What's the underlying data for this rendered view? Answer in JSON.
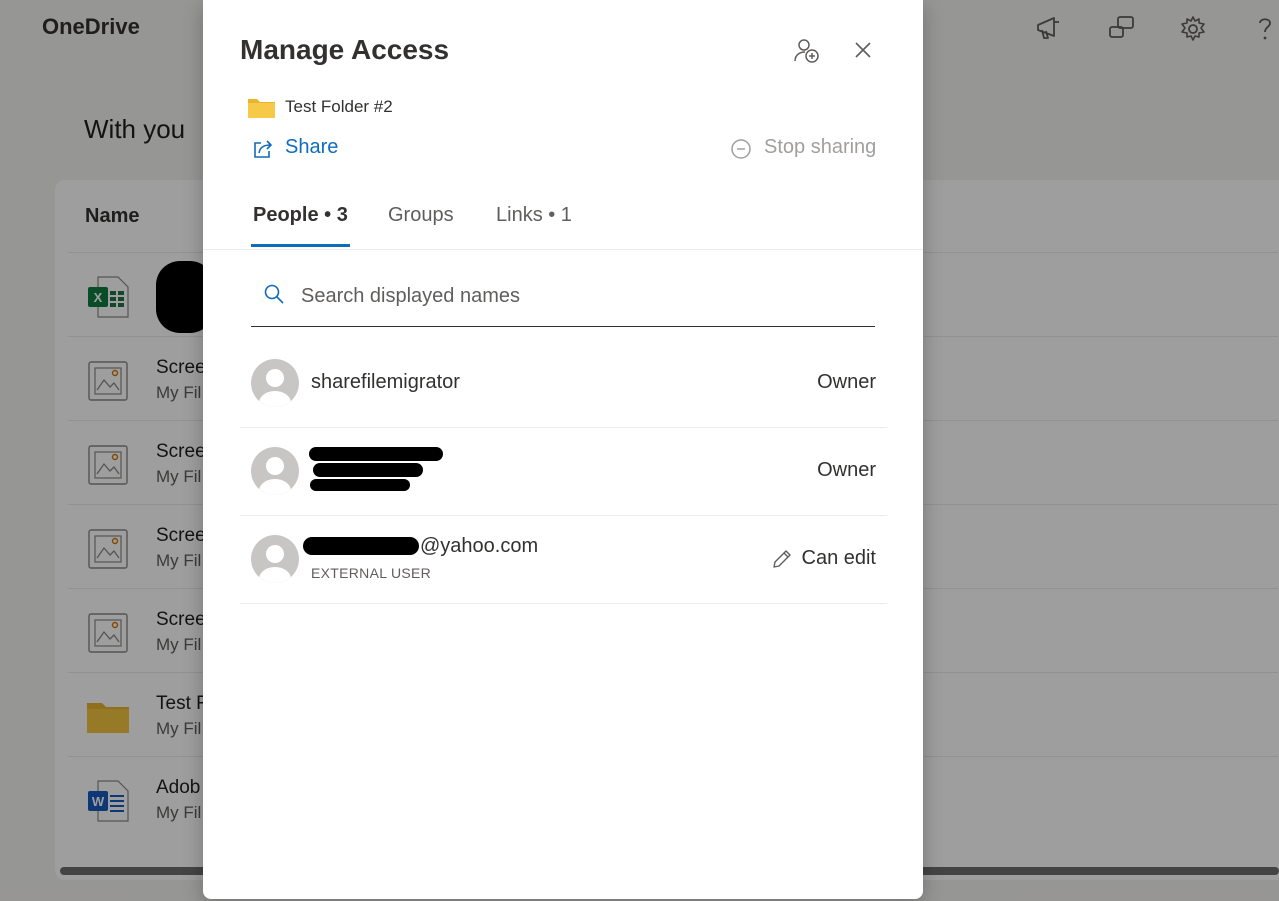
{
  "app": {
    "brand": "OneDrive",
    "page_title": "With you",
    "column_name": "Name",
    "files": [
      {
        "name": "",
        "location": "",
        "icon": "excel-icon"
      },
      {
        "name": "Scree",
        "location": "My Fil",
        "icon": "image-file-icon"
      },
      {
        "name": "Scree",
        "location": "My Fil",
        "icon": "image-file-icon"
      },
      {
        "name": "Scree",
        "location": "My Fil",
        "icon": "image-file-icon"
      },
      {
        "name": "Scree",
        "location": "My Fil",
        "icon": "image-file-icon"
      },
      {
        "name": "Test F",
        "location": "My Fil",
        "icon": "folder-icon"
      },
      {
        "name": "Adob",
        "location": "My Fil",
        "icon": "word-icon"
      }
    ]
  },
  "modal": {
    "title": "Manage Access",
    "folder_name": "Test Folder #2",
    "share_label": "Share",
    "stop_sharing_label": "Stop sharing",
    "tabs": [
      {
        "label": "People • 3",
        "active": true
      },
      {
        "label": "Groups",
        "active": false
      },
      {
        "label": "Links • 1",
        "active": false
      }
    ],
    "search_placeholder": "Search displayed names",
    "people": [
      {
        "name": "sharefilemigrator",
        "subtitle": "",
        "role": "Owner"
      },
      {
        "name": "",
        "subtitle": "",
        "role": "Owner"
      },
      {
        "name": "@yahoo.com",
        "subtitle": "EXTERNAL USER",
        "role": "Can edit"
      }
    ]
  },
  "colors": {
    "accent": "#0f6cbd",
    "disabled_text": "#a19f9d",
    "folder_yellow": "#f4c542"
  }
}
